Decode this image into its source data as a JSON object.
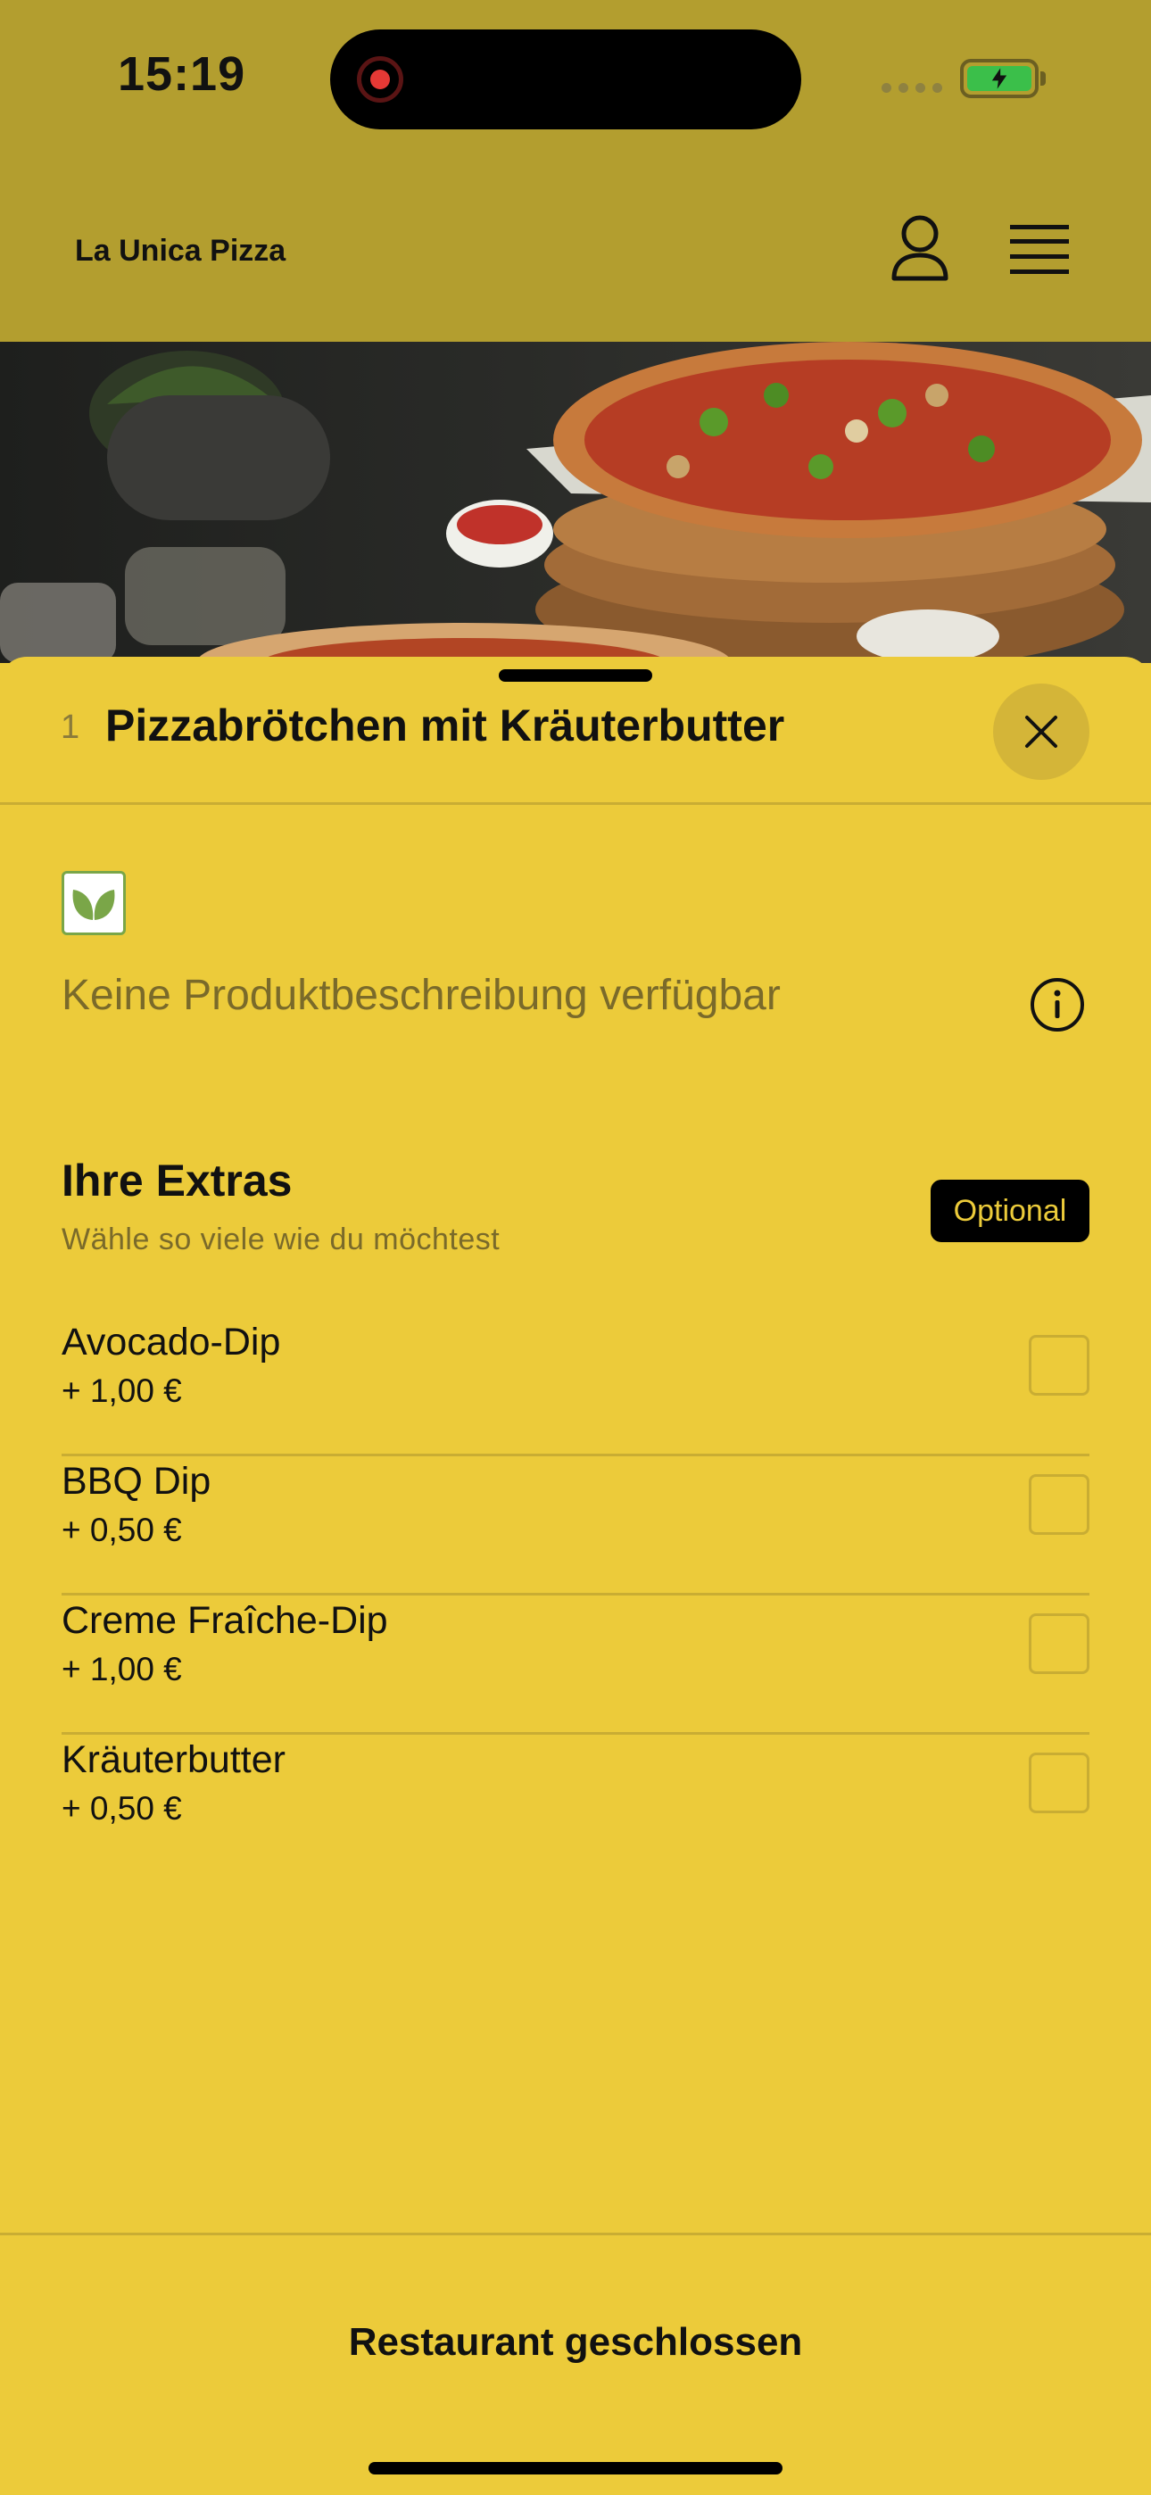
{
  "status_bar": {
    "time": "15:19"
  },
  "header": {
    "brand": "La Unica Pizza"
  },
  "product": {
    "quantity": "1",
    "title": "Pizzabrötchen mit Kräuterbutter",
    "description": "Keine Produktbeschreibung verfügbar"
  },
  "extras": {
    "title": "Ihre Extras",
    "subtitle": "Wähle so viele wie du möchtest",
    "badge": "Optional",
    "items": [
      {
        "name": "Avocado-Dip",
        "price": "+ 1,00 €"
      },
      {
        "name": "BBQ Dip",
        "price": "+ 0,50 €"
      },
      {
        "name": "Creme Fraîche-Dip",
        "price": "+ 1,00 €"
      },
      {
        "name": "Kräuterbutter",
        "price": "+ 0,50 €"
      }
    ]
  },
  "footer": {
    "status_button": "Restaurant geschlossen"
  },
  "colors": {
    "sheet_background": "#ECCB3A",
    "header_background": "#B39E2F",
    "badge_background": "#000000",
    "veg_green": "#7aa648"
  },
  "icons": [
    "user-icon",
    "menu-icon",
    "close-icon",
    "leaf-icon",
    "info-icon",
    "battery-icon",
    "record-icon"
  ]
}
